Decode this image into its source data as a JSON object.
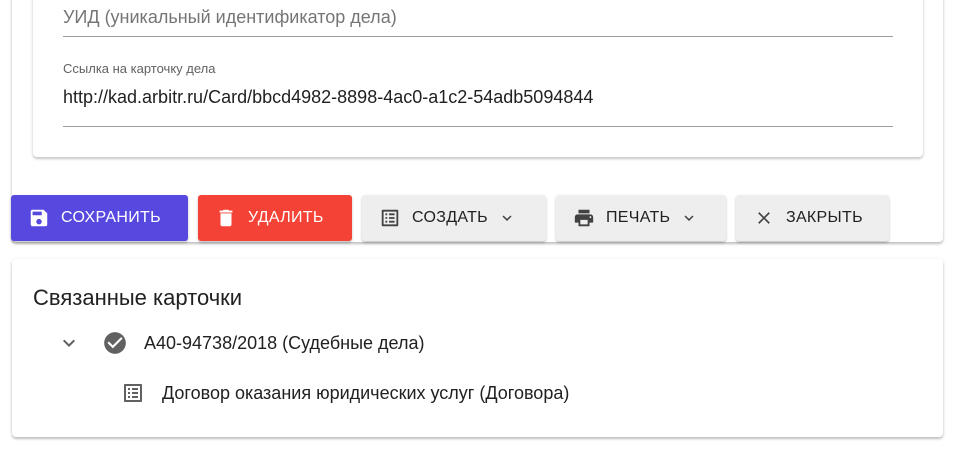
{
  "form": {
    "uid_placeholder": "УИД (уникальный идентификатор дела)",
    "link_label": "Ссылка на карточку дела",
    "link_value": "http://kad.arbitr.ru/Card/bbcd4982-8898-4ac0-a1c2-54adb5094844"
  },
  "toolbar": {
    "save_label": "СОХРАНИТЬ",
    "delete_label": "УДАЛИТЬ",
    "create_label": "СОЗДАТЬ",
    "print_label": "ПЕЧАТЬ",
    "close_label": "ЗАКРЫТЬ"
  },
  "related": {
    "title": "Связанные карточки",
    "items": [
      {
        "label": "А40-94738/2018 (Судебные дела)",
        "icon": "check-circle-icon",
        "expanded": true
      },
      {
        "label": "Договор оказания юридических услуг (Договора)",
        "icon": "list-icon"
      }
    ]
  },
  "colors": {
    "primary": "#5748e0",
    "danger": "#f44336",
    "neutral_button": "#eeeeee"
  }
}
